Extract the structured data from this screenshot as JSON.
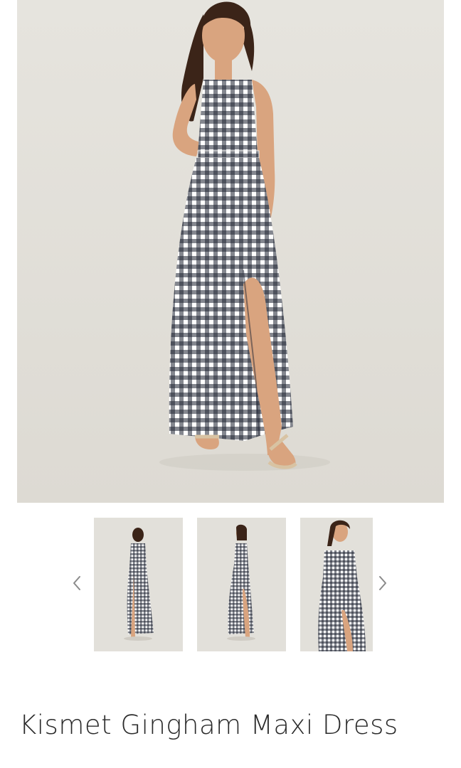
{
  "product": {
    "title": "Kismet Gingham Maxi Dress"
  },
  "gallery": {
    "main_image": "model-wearing-gingham-maxi-dress",
    "thumbnails": [
      {
        "image": "back-view"
      },
      {
        "image": "front-view"
      },
      {
        "image": "close-up-view"
      }
    ],
    "prev_icon": "chevron-left-icon",
    "next_icon": "chevron-right-icon"
  },
  "colors": {
    "background": "#e4e2dc",
    "gingham_dark": "#1f2433",
    "gingham_light": "#ffffff",
    "skin": "#d9a47f",
    "hair": "#3b2418",
    "sandal": "#d8c3a3",
    "arrow": "#8a8a8a",
    "title": "#2a2a2a"
  }
}
